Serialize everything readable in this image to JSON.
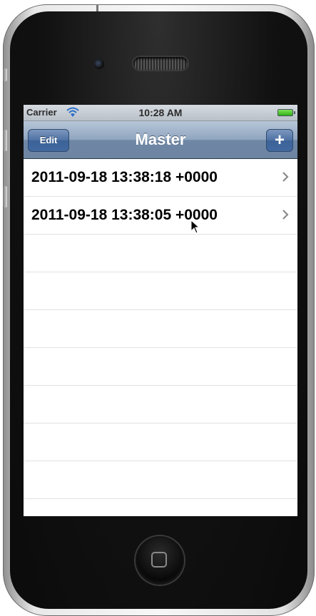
{
  "status_bar": {
    "carrier": "Carrier",
    "time": "10:28 AM"
  },
  "nav_bar": {
    "title": "Master",
    "edit_label": "Edit",
    "add_label": "+"
  },
  "table": {
    "rows": [
      {
        "label": "2011-09-18 13:38:18 +0000"
      },
      {
        "label": "2011-09-18 13:38:05 +0000"
      }
    ],
    "empty_rows": 8
  },
  "icons": {
    "wifi": "wifi-icon",
    "battery": "battery-icon",
    "add": "plus-icon",
    "disclosure": "chevron-right-icon",
    "cursor": "cursor-icon",
    "camera": "camera-icon",
    "home": "home-button-icon"
  },
  "colors": {
    "nav_bar": "#8fa5bf",
    "button": "#426aa0",
    "battery": "#2fae12"
  }
}
